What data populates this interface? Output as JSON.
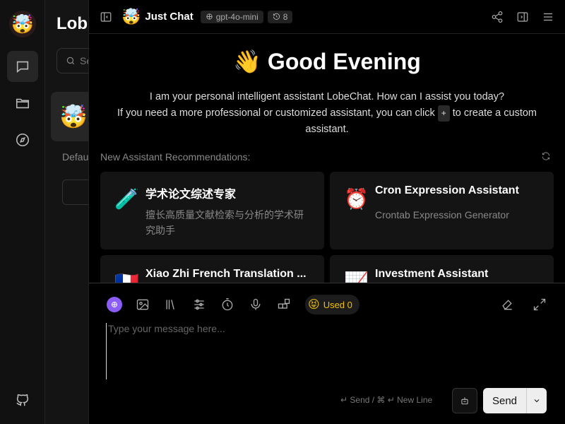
{
  "app": {
    "title": "LobeChat"
  },
  "rail": {
    "avatar": "🤯",
    "items": [
      {
        "name": "chat",
        "icon": "chat-bubble-icon",
        "active": true
      },
      {
        "name": "files",
        "icon": "folder-icon",
        "active": false
      },
      {
        "name": "discover",
        "icon": "compass-icon",
        "active": false
      }
    ],
    "bottom": [
      {
        "name": "github",
        "icon": "github-icon"
      }
    ]
  },
  "session": {
    "title": "Lobe",
    "search_placeholder": "Se",
    "item_avatar": "🤯",
    "default_label": "Defau"
  },
  "header": {
    "avatar": "🤯",
    "title": "Just Chat",
    "model": "gpt-4o-mini",
    "history_count": "8"
  },
  "main": {
    "greeting_emoji": "👋",
    "greeting": "Good Evening",
    "intro_line1": "I am your personal intelligent assistant LobeChat. How can I assist you today?",
    "intro_line2_pre": "If you need a more professional or customized assistant, you can click",
    "intro_kbd": "+",
    "intro_line2_post": "to create a custom assistant.",
    "recommend_label": "New Assistant Recommendations:",
    "cards": [
      {
        "icon": "🧪",
        "title": "学术论文综述专家",
        "desc": "擅长高质量文献检索与分析的学术研究助手"
      },
      {
        "icon": "⏰",
        "title": "Cron Expression Assistant",
        "desc": "Crontab Expression Generator"
      },
      {
        "icon": "🇫🇷",
        "title": "Xiao Zhi French Translation ...",
        "desc": ""
      },
      {
        "icon": "📈",
        "title": "Investment Assistant",
        "desc": ""
      }
    ]
  },
  "composer": {
    "used_label": "Used 0",
    "used_emoji": "😝",
    "placeholder": "Type your message here...",
    "hint": "↵ Send / ⌘ ↵ New Line",
    "send_label": "Send"
  },
  "colors": {
    "accent": "#8b5cf6",
    "used_text": "#f0c000"
  }
}
